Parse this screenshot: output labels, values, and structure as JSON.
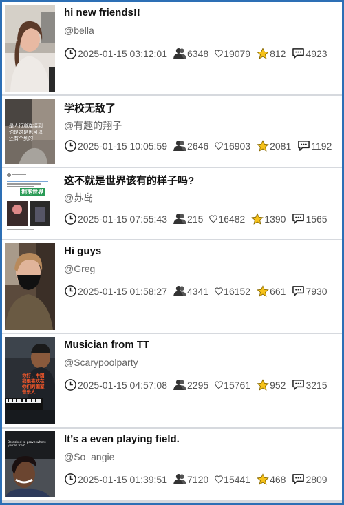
{
  "icons": {
    "time": "clock-icon",
    "views": "people-icon",
    "likes": "heart-icon",
    "favorites": "star-icon",
    "comments": "comment-icon"
  },
  "colors": {
    "frame": "#2d6fb5",
    "star": "#f6c21a",
    "text": "#111111",
    "muted": "#666666"
  },
  "posts": [
    {
      "title": "hi new friends!!",
      "author": "@bella",
      "time": "2025-01-15 03:12:01",
      "views": "6348",
      "likes": "19079",
      "favorites": "812",
      "comments": "4923"
    },
    {
      "title": "学校无敌了",
      "author": "@有趣的翔子",
      "time": "2025-01-15 10:05:59",
      "views": "2646",
      "likes": "16903",
      "favorites": "2081",
      "comments": "1192",
      "thumb_caption": "是人行道连接到\n你是这是也可以\n还有个到的"
    },
    {
      "title": "这不就是世界该有的样子吗?",
      "author": "@苏岛",
      "time": "2025-01-15 07:55:43",
      "views": "215",
      "likes": "16482",
      "favorites": "1390",
      "comments": "1565",
      "thumb_caption": "拥抱世界"
    },
    {
      "title": "Hi guys",
      "author": "@Greg",
      "time": "2025-01-15 01:58:27",
      "views": "4341",
      "likes": "16152",
      "favorites": "661",
      "comments": "7930"
    },
    {
      "title": "Musician from TT",
      "author": "@Scarypoolparty",
      "time": "2025-01-15 04:57:08",
      "views": "2295",
      "likes": "15761",
      "favorites": "952",
      "comments": "3215",
      "thumb_caption": "你好，中国\n我很喜欢在\n你们的国家\n音乐人"
    },
    {
      "title": "It’s a even playing field.",
      "author": "@So_angie",
      "time": "2025-01-15 01:39:51",
      "views": "7120",
      "likes": "15441",
      "favorites": "468",
      "comments": "2809",
      "thumb_caption": "Be asked to prove where you're from"
    }
  ]
}
